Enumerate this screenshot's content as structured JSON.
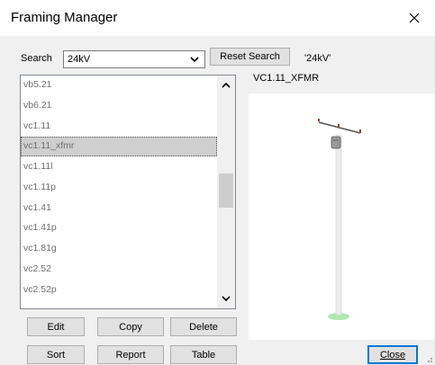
{
  "window": {
    "title": "Framing Manager"
  },
  "search": {
    "label": "Search",
    "value": "24kV",
    "reset_label": "Reset Search",
    "current_filter": "'24kV'"
  },
  "list": {
    "items": [
      "vb5.21",
      "vb6.21",
      "vc1.11",
      "vc1.11_xfmr",
      "vc1.11l",
      "vc1.11p",
      "vc1.41",
      "vc1.41p",
      "vc1.81g",
      "vc2.52",
      "vc2.52p"
    ],
    "selected": "vc1.11_xfmr",
    "scroll_position": 0.49
  },
  "preview": {
    "title": "VC1.11_XFMR"
  },
  "buttons": {
    "edit": "Edit",
    "copy": "Copy",
    "delete": "Delete",
    "sort": "Sort",
    "report": "Report",
    "table": "Table",
    "close": "Close"
  },
  "icons": [
    "close-icon",
    "chevron-down-icon",
    "chevron-up-icon",
    "size-grip-icon"
  ]
}
